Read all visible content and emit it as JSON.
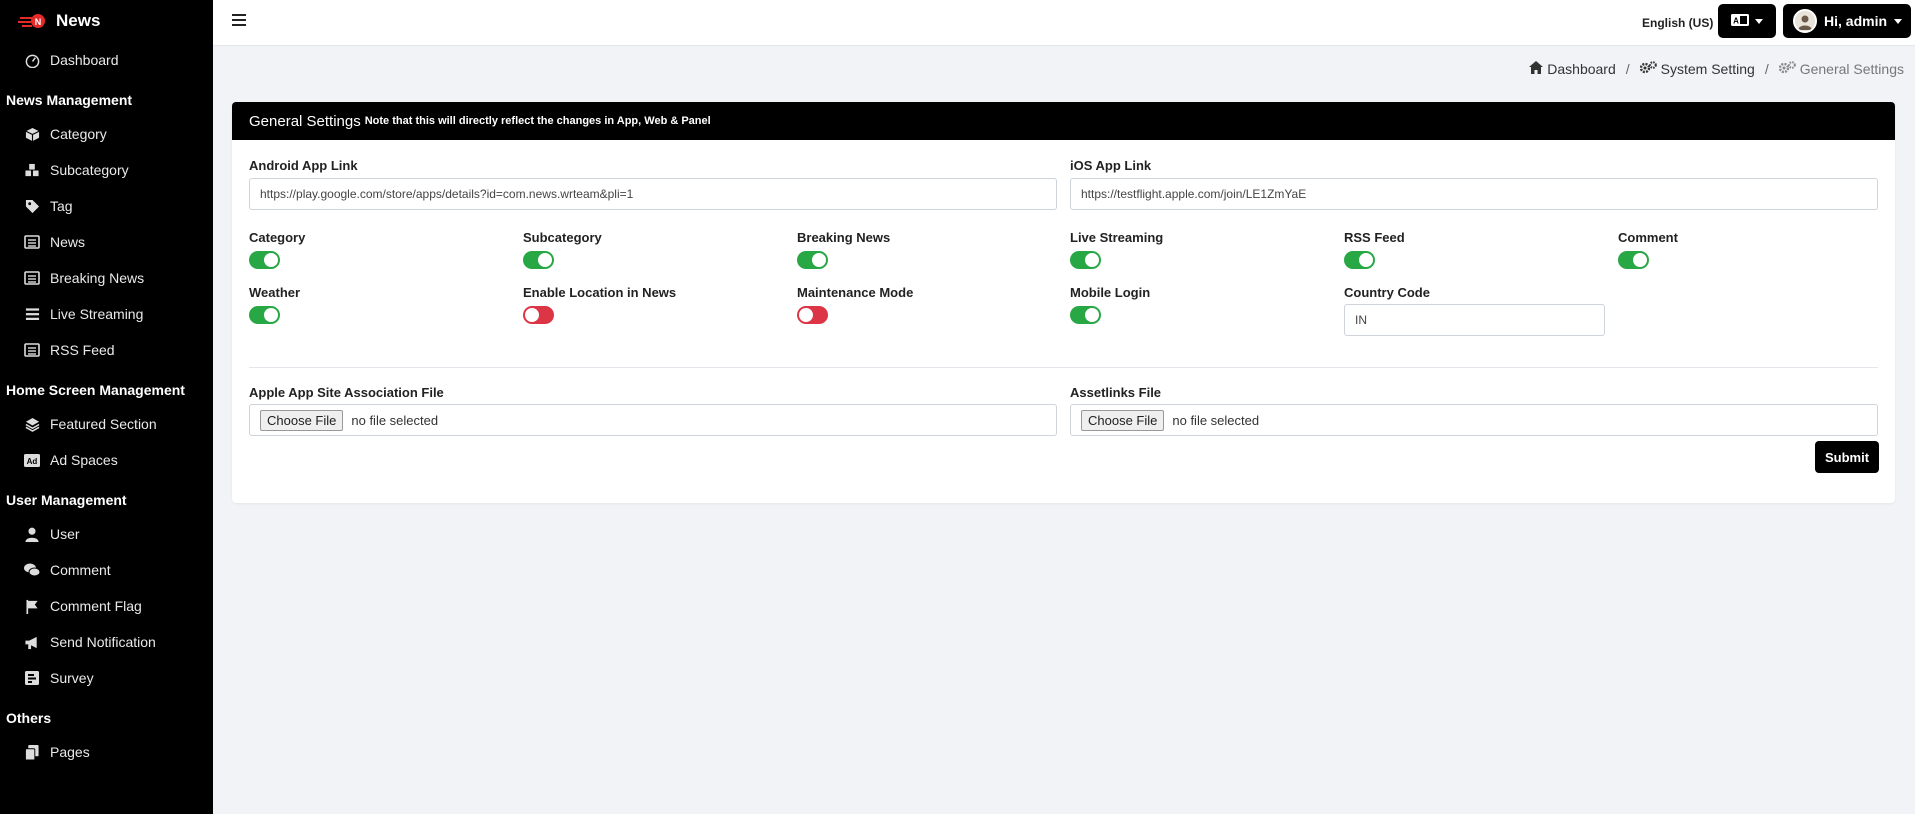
{
  "brand": {
    "title": "News"
  },
  "sidebar": {
    "dashboard": "Dashboard",
    "sections": [
      {
        "title": "News Management",
        "items": [
          "Category",
          "Subcategory",
          "Tag",
          "News",
          "Breaking News",
          "Live Streaming",
          "RSS Feed"
        ]
      },
      {
        "title": "Home Screen Management",
        "items": [
          "Featured Section",
          "Ad Spaces"
        ]
      },
      {
        "title": "User Management",
        "items": [
          "User",
          "Comment",
          "Comment Flag",
          "Send Notification",
          "Survey"
        ]
      },
      {
        "title": "Others",
        "items": [
          "Pages"
        ]
      }
    ]
  },
  "topbar": {
    "language_label": "English (US)",
    "user_label": "Hi, admin"
  },
  "breadcrumb": {
    "home": "Dashboard",
    "system": "System Setting",
    "current": "General Settings"
  },
  "card": {
    "title": "General Settings",
    "note": "Note that this will directly reflect the changes in App, Web & Panel",
    "android_label": "Android App Link",
    "android_value": "https://play.google.com/store/apps/details?id=com.news.wrteam&pli=1",
    "ios_label": "iOS App Link",
    "ios_value": "https://testflight.apple.com/join/LE1ZmYaE",
    "toggles": [
      {
        "label": "Category",
        "on": true
      },
      {
        "label": "Subcategory",
        "on": true
      },
      {
        "label": "Breaking News",
        "on": true
      },
      {
        "label": "Live Streaming",
        "on": true
      },
      {
        "label": "RSS Feed",
        "on": true
      },
      {
        "label": "Comment",
        "on": true
      },
      {
        "label": "Weather",
        "on": true
      },
      {
        "label": "Enable Location in News",
        "on": false
      },
      {
        "label": "Maintenance Mode",
        "on": false
      },
      {
        "label": "Mobile Login",
        "on": true
      }
    ],
    "country_code_label": "Country Code",
    "country_code_value": "IN",
    "apple_file_label": "Apple App Site Association File",
    "assetlinks_label": "Assetlinks File",
    "choose_file": "Choose File",
    "no_file": "no file selected",
    "submit": "Submit"
  },
  "colors": {
    "toggle_on": "#28a745",
    "toggle_off": "#dc3545",
    "accent": "#000000"
  }
}
